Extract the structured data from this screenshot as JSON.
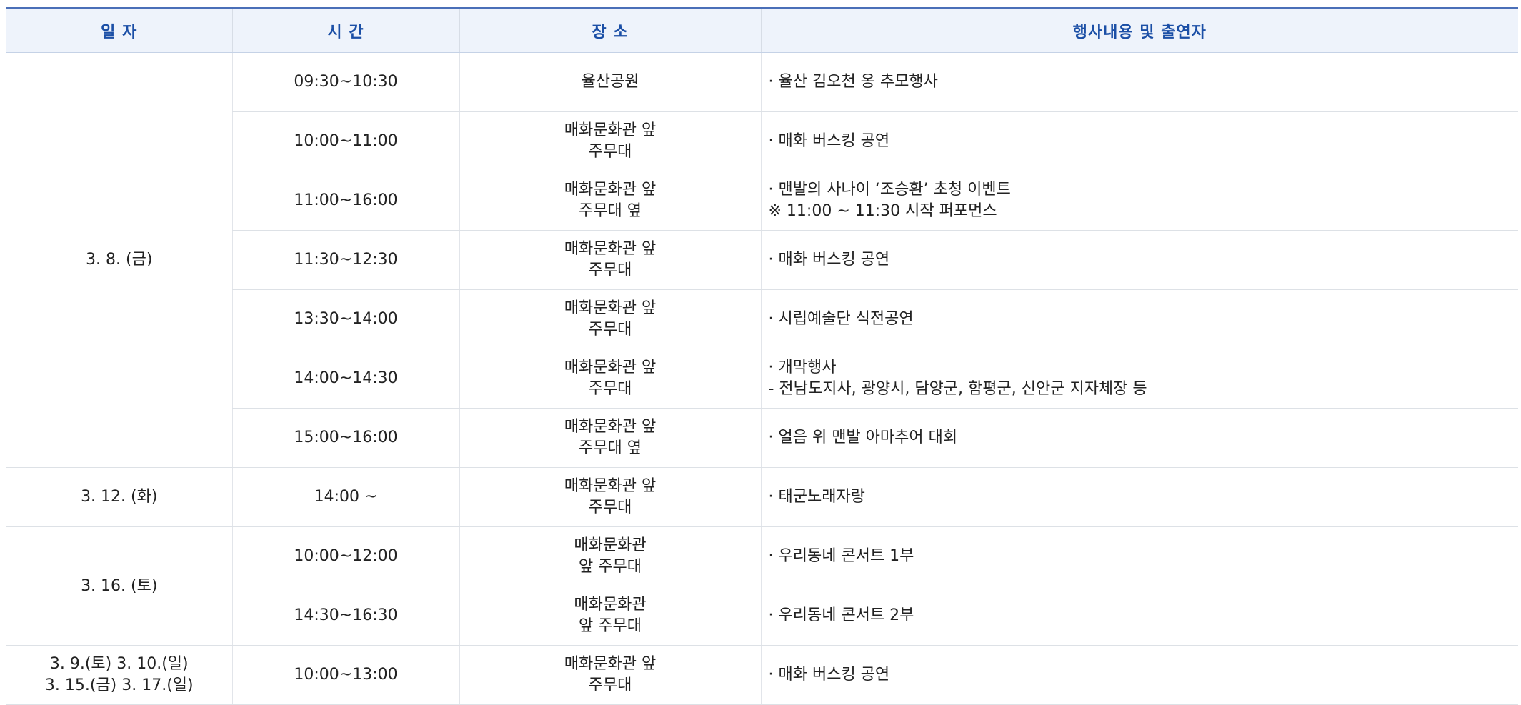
{
  "headers": {
    "date": "일 자",
    "time": "시 간",
    "place": "장 소",
    "content": "행사내용 및 출연자"
  },
  "rows": [
    {
      "date": "3. 8. (금)",
      "time": "09:30~10:30",
      "place": [
        "율산공원"
      ],
      "content": [
        "· 율산 김오천 옹 추모행사"
      ]
    },
    {
      "time": "10:00~11:00",
      "place": [
        "매화문화관 앞",
        "주무대"
      ],
      "content": [
        "· 매화 버스킹 공연"
      ]
    },
    {
      "time": "11:00~16:00",
      "place": [
        "매화문화관 앞",
        "주무대 옆"
      ],
      "content": [
        "· 맨발의 사나이 ‘조승환’ 초청 이벤트",
        "※ 11:00 ~ 11:30 시작 퍼포먼스"
      ]
    },
    {
      "time": "11:30~12:30",
      "place": [
        "매화문화관 앞",
        "주무대"
      ],
      "content": [
        "· 매화 버스킹 공연"
      ]
    },
    {
      "time": "13:30~14:00",
      "place": [
        "매화문화관 앞",
        "주무대"
      ],
      "content": [
        "· 시립예술단 식전공연"
      ]
    },
    {
      "time": "14:00~14:30",
      "place": [
        "매화문화관 앞",
        "주무대"
      ],
      "content": [
        "· 개막행사",
        "- 전남도지사, 광양시, 담양군, 함평군, 신안군 지자체장 등"
      ]
    },
    {
      "time": "15:00~16:00",
      "place": [
        "매화문화관 앞",
        "주무대 옆"
      ],
      "content": [
        "· 얼음 위 맨발 아마추어 대회"
      ]
    },
    {
      "date": "3. 12. (화)",
      "time": "14:00 ~",
      "place": [
        "매화문화관 앞",
        "주무대"
      ],
      "content": [
        "· 태군노래자랑"
      ]
    },
    {
      "date": "3. 16. (토)",
      "time": "10:00~12:00",
      "place": [
        "매화문화관",
        "앞 주무대"
      ],
      "content": [
        "· 우리동네 콘서트 1부"
      ]
    },
    {
      "time": "14:30~16:30",
      "place": [
        "매화문화관",
        "앞 주무대"
      ],
      "content": [
        "· 우리동네 콘서트 2부"
      ]
    },
    {
      "date": [
        "3. 9.(토) 3. 10.(일)",
        "3. 15.(금) 3. 17.(일)"
      ],
      "time": "10:00~13:00",
      "place": [
        "매화문화관 앞",
        "주무대"
      ],
      "content": [
        "· 매화 버스킹 공연"
      ]
    }
  ]
}
